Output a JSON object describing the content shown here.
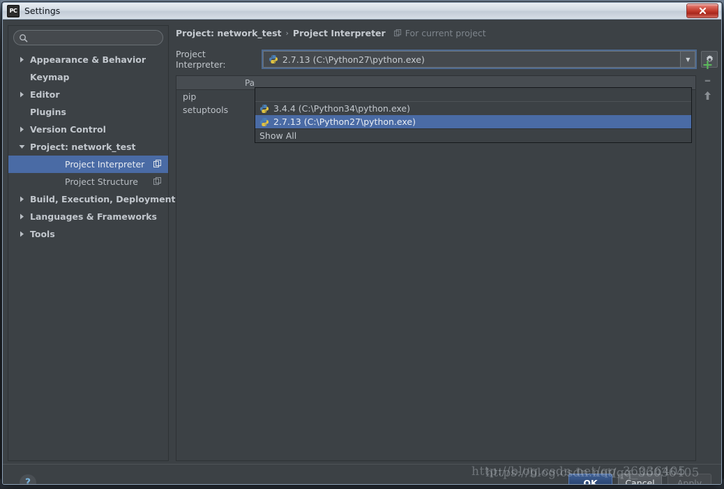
{
  "window": {
    "title": "Settings",
    "app_icon": "pycharm-icon",
    "close_label": "✕"
  },
  "search": {
    "value": "",
    "placeholder": "",
    "icon": "search-icon"
  },
  "sidebar": {
    "items": [
      {
        "label": "Appearance & Behavior",
        "arrow": "collapsed",
        "indent": false,
        "bold": true,
        "selected": false,
        "module_icon": false
      },
      {
        "label": "Keymap",
        "arrow": "none",
        "indent": false,
        "bold": true,
        "selected": false,
        "module_icon": false
      },
      {
        "label": "Editor",
        "arrow": "collapsed",
        "indent": false,
        "bold": true,
        "selected": false,
        "module_icon": false
      },
      {
        "label": "Plugins",
        "arrow": "none",
        "indent": false,
        "bold": true,
        "selected": false,
        "module_icon": false
      },
      {
        "label": "Version Control",
        "arrow": "collapsed",
        "indent": false,
        "bold": true,
        "selected": false,
        "module_icon": false
      },
      {
        "label": "Project: network_test",
        "arrow": "expanded",
        "indent": false,
        "bold": true,
        "selected": false,
        "module_icon": false
      },
      {
        "label": "Project Interpreter",
        "arrow": "none",
        "indent": true,
        "bold": false,
        "selected": true,
        "module_icon": true
      },
      {
        "label": "Project Structure",
        "arrow": "none",
        "indent": true,
        "bold": false,
        "selected": false,
        "module_icon": true
      },
      {
        "label": "Build, Execution, Deployment",
        "arrow": "collapsed",
        "indent": false,
        "bold": true,
        "selected": false,
        "module_icon": false
      },
      {
        "label": "Languages & Frameworks",
        "arrow": "collapsed",
        "indent": false,
        "bold": true,
        "selected": false,
        "module_icon": false
      },
      {
        "label": "Tools",
        "arrow": "collapsed",
        "indent": false,
        "bold": true,
        "selected": false,
        "module_icon": false
      }
    ]
  },
  "breadcrumb": {
    "project": "Project: network_test",
    "separator": "›",
    "page": "Project Interpreter",
    "scope_note": "For current project",
    "scope_icon": "module-icon"
  },
  "interpreter": {
    "label": "Project Interpreter:",
    "selected_value": "2.7.13 (C:\\Python27\\python.exe)",
    "icon": "python-icon",
    "dropdown_arrow": "▼",
    "gear_icon": "gear-icon"
  },
  "dropdown": {
    "blank_row": "",
    "options": [
      {
        "label": "3.4.4 (C:\\Python34\\python.exe)",
        "icon": "python-icon",
        "selected": false
      },
      {
        "label": "2.7.13 (C:\\Python27\\python.exe)",
        "icon": "python-icon",
        "selected": true
      }
    ],
    "show_all_label": "Show All"
  },
  "packages": {
    "columns": [
      "Package"
    ],
    "truncated_header": "Pa",
    "rows": [
      {
        "name": "pip"
      },
      {
        "name": "setuptools"
      }
    ],
    "tools": {
      "add": "+",
      "remove": "–",
      "upgrade": "upgrade-arrow-icon"
    }
  },
  "footer": {
    "help_label": "?",
    "ok_label": "OK",
    "cancel_label": "Cancel",
    "apply_label": "Apply"
  },
  "watermarks": {
    "line_a": "http://blog.csdn.net/qq_36036405",
    "line_b": "https://blog.csdn.net/qq_36036405"
  },
  "colors": {
    "accent_selection": "#4a6ba5",
    "dialog_bg": "#3c4145",
    "ok_button": "#2c4876",
    "plus_green": "#5bb85b",
    "help_blue": "#7bb6e0"
  }
}
